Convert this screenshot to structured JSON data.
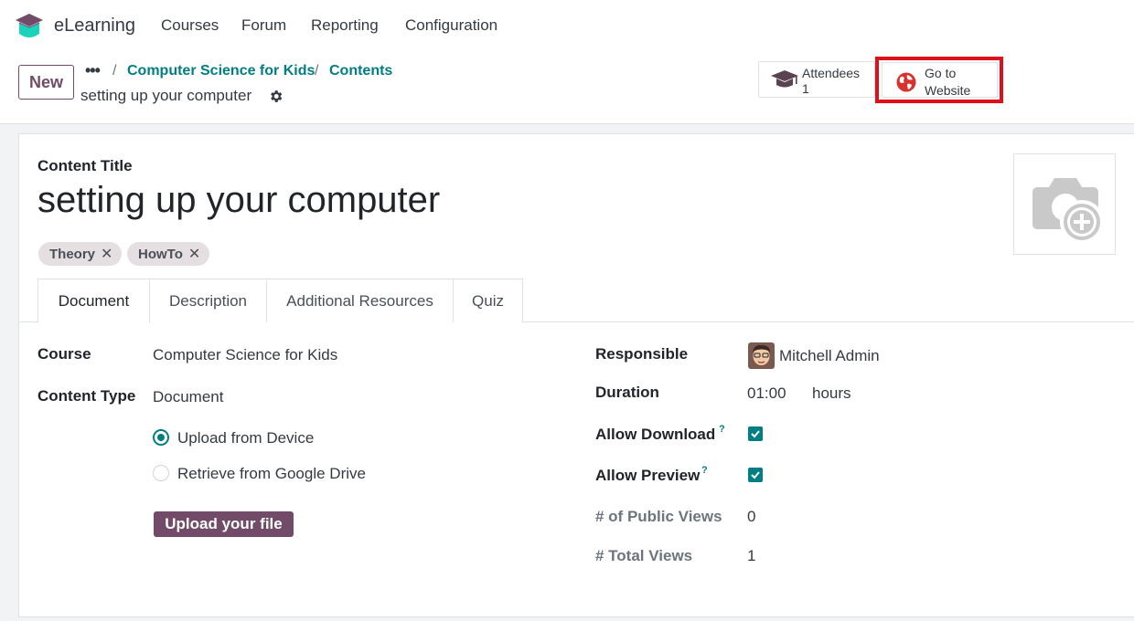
{
  "navbar": {
    "app_name": "eLearning",
    "menu": [
      "Courses",
      "Forum",
      "Reporting",
      "Configuration"
    ]
  },
  "control_panel": {
    "new_label": "New",
    "breadcrumbs": [
      "Computer Science for Kids",
      "Contents"
    ],
    "record_name": "setting up your computer",
    "attendees_label": "Attendees",
    "attendees_count": "1",
    "website_label_line1": "Go to",
    "website_label_line2": "Website"
  },
  "form": {
    "content_title_label": "Content Title",
    "content_title": "setting up your computer",
    "tags": [
      "Theory",
      "HowTo"
    ],
    "tabs": [
      "Document",
      "Description",
      "Additional Resources",
      "Quiz"
    ],
    "active_tab": "Document",
    "course_label": "Course",
    "course_value": "Computer Science for Kids",
    "content_type_label": "Content Type",
    "content_type_value": "Document",
    "source_options": [
      "Upload from Device",
      "Retrieve from Google Drive"
    ],
    "selected_source": "Upload from Device",
    "upload_button": "Upload your file",
    "responsible_label": "Responsible",
    "responsible_value": "Mitchell Admin",
    "duration_label": "Duration",
    "duration_value": "01:00",
    "duration_unit": "hours",
    "allow_download_label": "Allow Download",
    "allow_download": true,
    "allow_preview_label": "Allow Preview",
    "allow_preview": true,
    "help_mark": "?",
    "public_views_label": "# of Public Views",
    "public_views_value": "0",
    "total_views_label": "# Total Views",
    "total_views_value": "1"
  },
  "colors": {
    "brand": "#714b67",
    "accent": "#017e84",
    "highlight_border": "#e0101a"
  },
  "icons": [
    "graduation-cap-icon",
    "gear-icon",
    "globe-icon",
    "close-icon",
    "camera-add-icon",
    "checkbox-checked-icon",
    "radio-icon",
    "avatar"
  ]
}
